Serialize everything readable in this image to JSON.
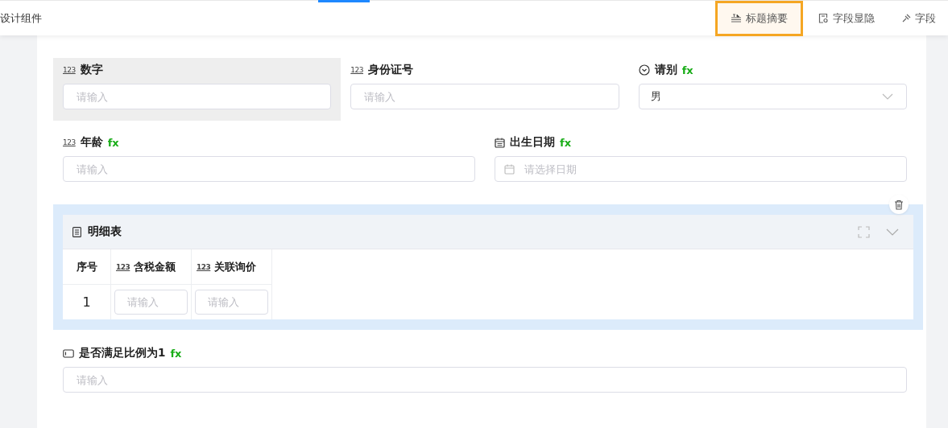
{
  "header": {
    "title": "设计组件",
    "tab_indicator": true
  },
  "toolbar": [
    {
      "kind": "title",
      "label": "标题摘要",
      "selected": true
    },
    {
      "kind": "visibility",
      "label": "字段显隐",
      "selected": false
    },
    {
      "kind": "pin",
      "label": "字段",
      "selected": false
    }
  ],
  "sections": [
    {
      "kind": "row",
      "fields": [
        {
          "kind": "number",
          "badge": "123",
          "label": "数字",
          "placeholder": "请输入",
          "selected": true
        },
        {
          "kind": "number",
          "badge": "123",
          "label": "身份证号",
          "placeholder": "请输入",
          "selected": false
        },
        {
          "kind": "select",
          "label": "请别",
          "formula": "fx",
          "value": "男",
          "selected": false
        }
      ]
    },
    {
      "kind": "row",
      "fields": [
        {
          "kind": "number",
          "badge": "123",
          "label": "年龄",
          "formula": "fx",
          "placeholder": "请输入",
          "selected": false
        },
        {
          "kind": "date",
          "label": "出生日期",
          "formula": "fx",
          "placeholder": "请选择日期",
          "selected": false
        }
      ]
    },
    {
      "kind": "subtable",
      "title": "明细表",
      "selected": true,
      "columns": [
        {
          "kind": "index",
          "label": "序号"
        },
        {
          "kind": "number",
          "badge": "123",
          "label": "含税金额"
        },
        {
          "kind": "number",
          "badge": "123",
          "label": "关联询价"
        }
      ],
      "rows": [
        {
          "cells": [
            {
              "kind": "index",
              "text": "1"
            },
            {
              "kind": "input",
              "placeholder": "请输入"
            },
            {
              "kind": "input",
              "placeholder": "请输入"
            }
          ]
        }
      ]
    },
    {
      "kind": "row",
      "fields": [
        {
          "kind": "text",
          "label": "是否满足比例为1",
          "formula": "fx",
          "placeholder": "请输入",
          "selected": false
        }
      ]
    }
  ]
}
